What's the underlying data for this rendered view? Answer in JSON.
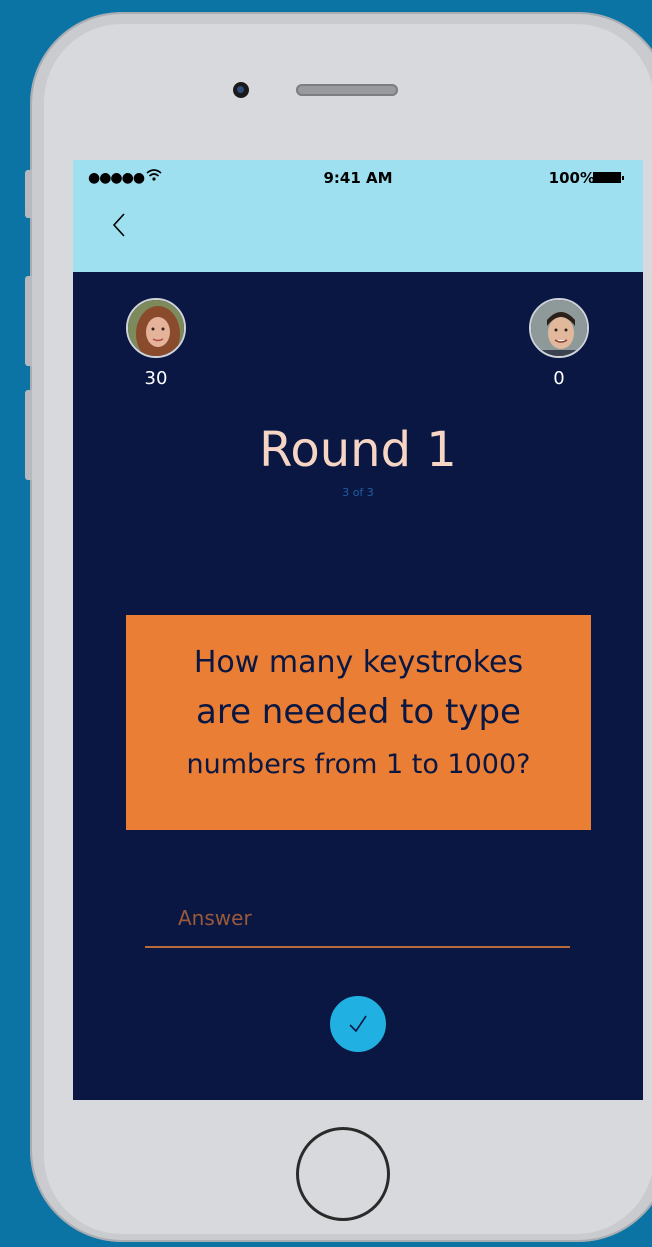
{
  "status": {
    "signal": "●●●●●",
    "time": "9:41 AM",
    "battery": "100%"
  },
  "players": [
    {
      "score": "30"
    },
    {
      "score": "0"
    }
  ],
  "round": {
    "title": "Round 1",
    "progress": "3 of 3"
  },
  "question": {
    "line1": "How many keystrokes",
    "line2": "are needed to type",
    "line3": "numbers from 1 to 1000?"
  },
  "answer": {
    "placeholder": "Answer",
    "value": ""
  },
  "colors": {
    "header": "#9fe0f0",
    "screen": "#0a1742",
    "question_card": "#ea7e35",
    "submit": "#20b1e2",
    "title": "#f7d5c5"
  },
  "icons": {
    "back": "chevron-left-icon",
    "wifi": "wifi-icon",
    "battery": "battery-icon",
    "submit": "checkmark-icon"
  }
}
